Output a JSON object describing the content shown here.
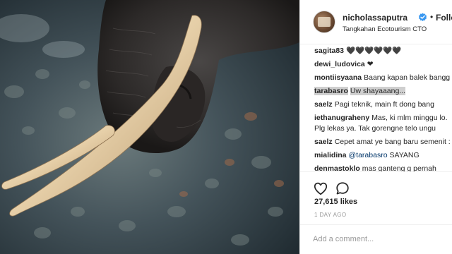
{
  "post": {
    "author": {
      "username": "nicholassaputra",
      "verified": true,
      "verified_icon": "verified-badge-icon",
      "follow_label": "Following",
      "separator": "•",
      "location": "Tangkahan Ecotourism CTO"
    },
    "photo": {
      "subject": "elephant-trunk-and-tusks-in-river"
    },
    "comments": [
      {
        "user": "sagita83",
        "text": "🖤🖤🖤🖤🖤🖤"
      },
      {
        "user": "dewi_ludovica",
        "text": "❤"
      },
      {
        "user": "montiisyaana",
        "text": "Baang kapan balek bangg"
      },
      {
        "user": "tarabasro",
        "text": "Uw shayaaang...",
        "highlighted": true
      },
      {
        "user": "saelz",
        "text": "Pagi teknik, main ft dong bang"
      },
      {
        "user": "iethanugraheny",
        "text": "Mas, ki mlm minggu lo."
      },
      {
        "user": "",
        "text": "Plg lekas ya. Tak gorengne telo ungu"
      },
      {
        "user": "saelz",
        "text": "Cepet amat ye bang baru semenit :"
      },
      {
        "user": "mialidina",
        "mention": "@tarabasro",
        "text": "SAYANG"
      },
      {
        "user": "denmastoklo",
        "text": "mas ganteng g pernah"
      }
    ],
    "actions": {
      "like_icon": "heart-icon",
      "comment_icon": "speech-bubble-icon"
    },
    "likes": "27,615 likes",
    "posted": "1 DAY AGO",
    "add_comment_placeholder": "Add a comment..."
  },
  "colors": {
    "text": "#262626",
    "muted": "#999999",
    "mention": "#003569",
    "verified": "#3897f0",
    "divider": "#efefef",
    "highlight": "#cfcfcf"
  }
}
